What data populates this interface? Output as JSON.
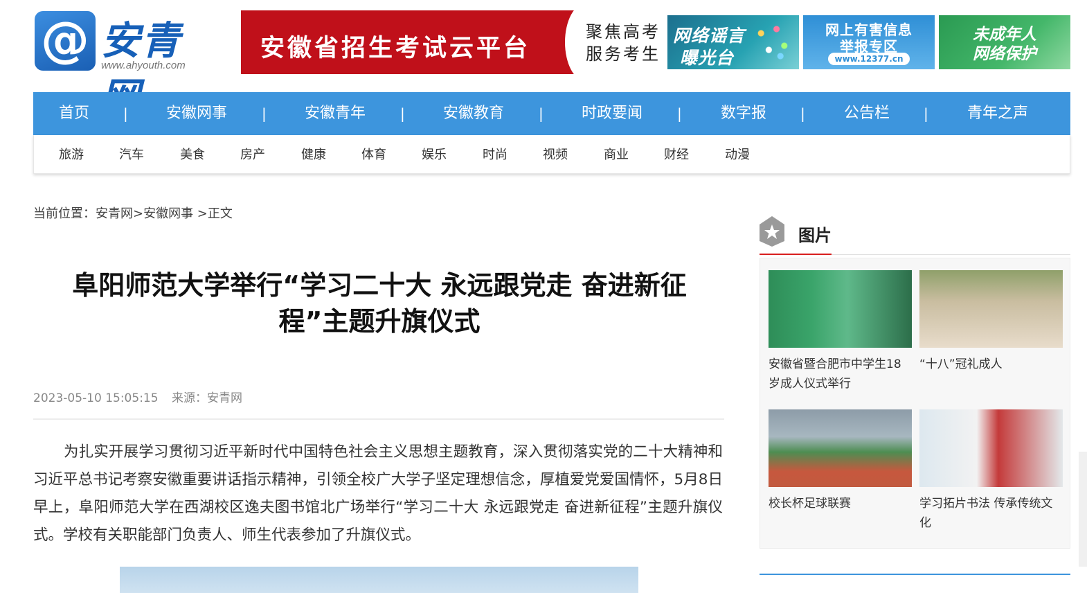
{
  "header": {
    "logo_name": "安青网",
    "logo_url": "www.ahyouth.com",
    "banner_text": "安徽省招生考试云平台",
    "slogan_line1": "聚焦高考",
    "slogan_line2": "服务考生",
    "promos": [
      {
        "line1": "网络谣言",
        "line2": "曝光台"
      },
      {
        "line1": "网上有害信息",
        "line2": "举报专区",
        "url": "www.12377.cn"
      },
      {
        "line1": "未成年人",
        "line2": "网络保护"
      }
    ]
  },
  "nav": {
    "items": [
      "首页",
      "安徽网事",
      "安徽青年",
      "安徽教育",
      "时政要闻",
      "数字报",
      "公告栏",
      "青年之声"
    ],
    "separator": "|",
    "sub_items": [
      "旅游",
      "汽车",
      "美食",
      "房产",
      "健康",
      "体育",
      "娱乐",
      "时尚",
      "视频",
      "商业",
      "财经",
      "动漫"
    ]
  },
  "breadcrumb": {
    "text": "当前位置：安青网>安徽网事 >正文"
  },
  "article": {
    "title": "阜阳师范大学举行“学习二十大 永远跟党走 奋进新征程”主题升旗仪式",
    "date": "2023-05-10 15:05:15",
    "source": "来源：安青网",
    "paragraph": "为扎实开展学习贯彻习近平新时代中国特色社会主义思想主题教育，深入贯彻落实党的二十大精神和习近平总书记考察安徽重要讲话指示精神，引领全校广大学子坚定理想信念，厚植爱党爱国情怀，5月8日早上，阜阳师范大学在西湖校区逸夫图书馆北广场举行“学习二十大 永远跟党走 奋进新征程”主题升旗仪式。学校有关职能部门负责人、师生代表参加了升旗仪式。"
  },
  "sidebar": {
    "title": "图片",
    "cards": [
      {
        "caption": "安徽省暨合肥市中学生18岁成人仪式举行"
      },
      {
        "caption": "“十八”冠礼成人"
      },
      {
        "caption": "校长杯足球联赛"
      },
      {
        "caption": "学习拓片书法 传承传统文化"
      }
    ]
  },
  "colors": {
    "nav_blue": "#3d95dd",
    "banner_red": "#c0101a",
    "accent_red": "#d81e1e"
  }
}
